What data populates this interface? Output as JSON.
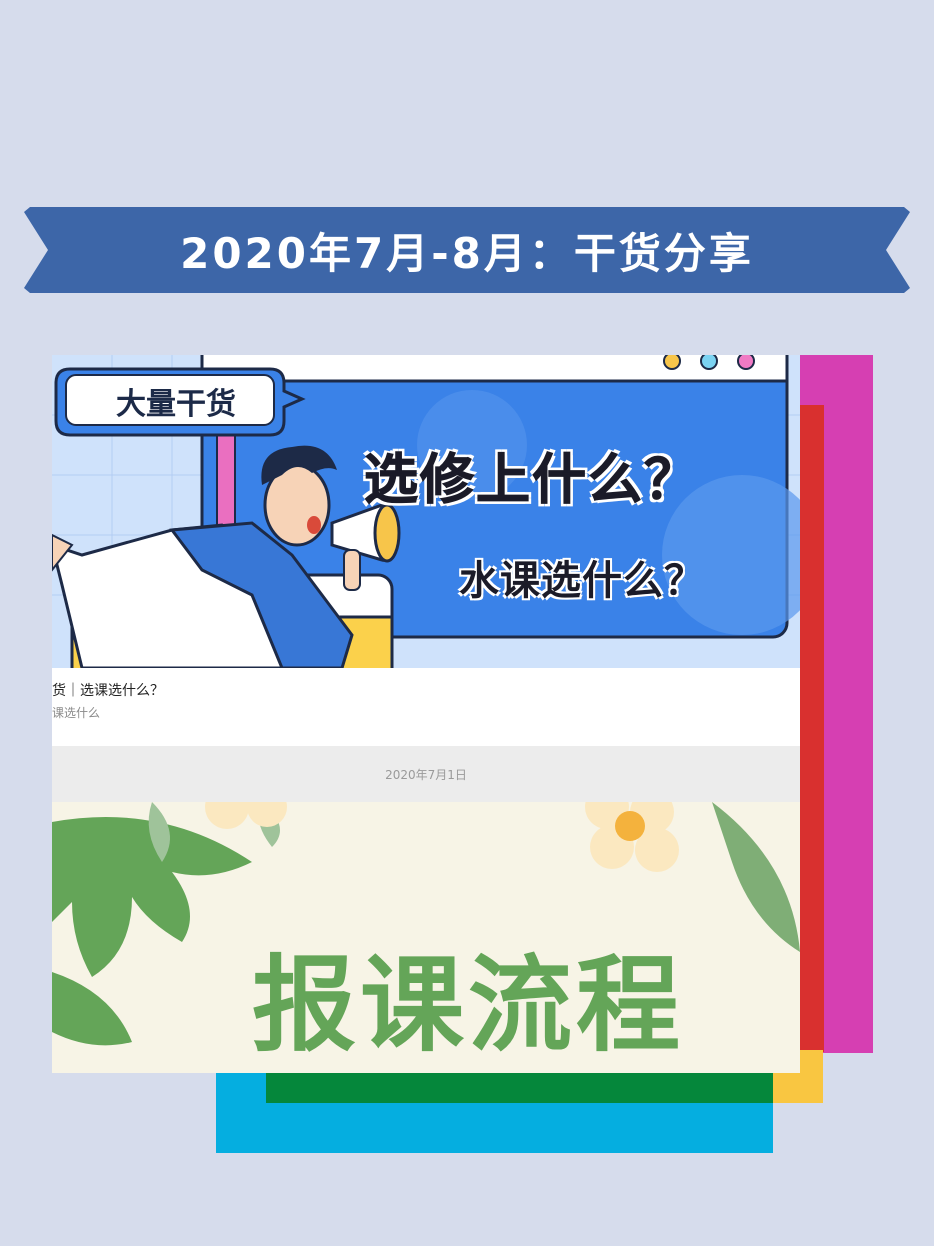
{
  "banner": {
    "title": "2020年7月-8月：干货分享"
  },
  "article1": {
    "tag": "大量干货",
    "headline_1": "选修上什么？",
    "headline_2": "水课选什么？",
    "caption_title": "货｜选课选什么？",
    "caption_sub": "课选什么"
  },
  "date": "2020年7月1日",
  "article2": {
    "title": "报课流程"
  },
  "colors": {
    "background": "#d6dcec",
    "banner": "#3d66a8",
    "hero_blue": "#3a82e8",
    "magenta": "#d63fb2",
    "red": "#d9302f",
    "yellow": "#f9c641",
    "cyan": "#05aee0",
    "green": "#05873b",
    "leaf_green": "#64a558"
  }
}
